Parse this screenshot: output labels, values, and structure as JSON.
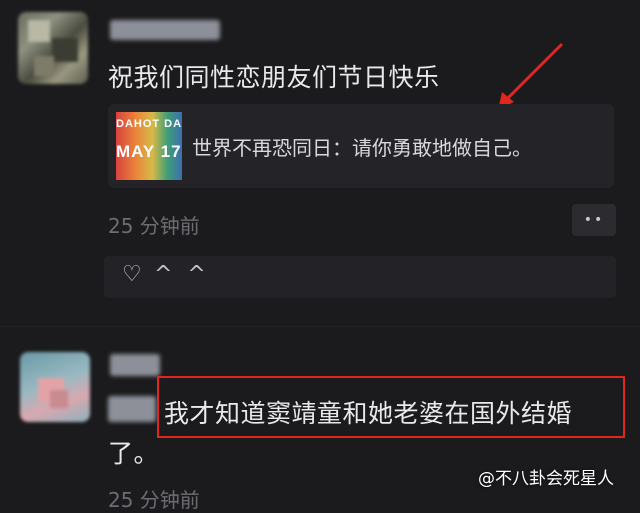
{
  "comment1": {
    "text": "祝我们同性恋朋友们节日快乐",
    "link_card": {
      "thumb_line1": "DAHOT DA",
      "thumb_line2": "MAY 17",
      "title": "世界不再恐同日：请你勇敢地做自己。"
    },
    "time": "25 分钟前",
    "more_label": "••",
    "like_icon": "heart-outline",
    "reactions": "^ ^"
  },
  "comment2": {
    "text_line1": "我才知道窦靖童和她老婆在国外结婚",
    "text_line2": "了。",
    "time": "25 分钟前"
  },
  "watermark": "@不八卦会死星人",
  "colors": {
    "background": "#1b1b1d",
    "annotation_red": "#e0261f",
    "text": "#e9e9ec",
    "meta": "#6c6d73"
  }
}
